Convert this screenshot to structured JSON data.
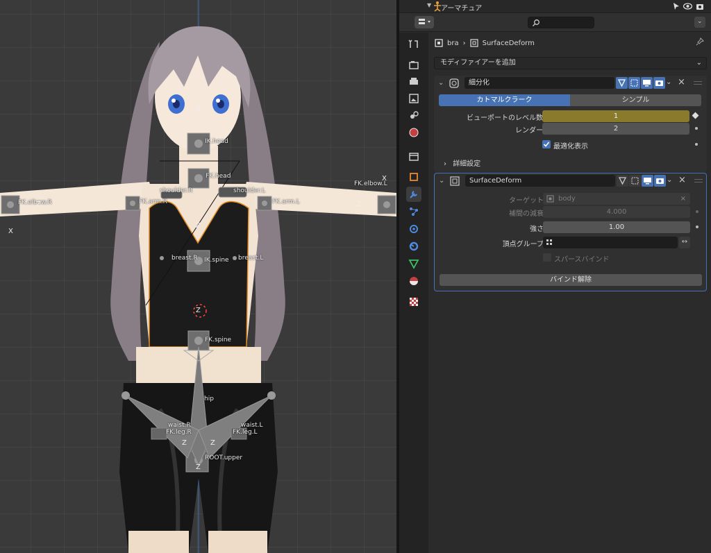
{
  "viewport": {
    "bones": {
      "ik_head": "IK.head",
      "fk_head": "FK.head",
      "shoulder_r": "shoulder.R",
      "shoulder_l": "shoulder.L",
      "fk_arm_r": "FK.arm.R",
      "fk_arm_l": "FK.arm.L",
      "fk_elbow_r": "FK.elbow.R",
      "fk_elbow_l": "FK.elbow.L",
      "breast_r": "breast.R",
      "breast_l": "breast.L",
      "ik_spine": "IK.spine",
      "fk_spine": "FK.spine",
      "hip": "hip",
      "waist_r": "waist.R",
      "waist_l": "waist.L",
      "fk_leg_r": "FK.leg.R",
      "fk_leg_l": "FK.leg.L",
      "root_upper": "ROOT.upper"
    },
    "axis": {
      "z": "Z",
      "x": "X"
    }
  },
  "outliner": {
    "title": "アーマチュア"
  },
  "header": {
    "search_placeholder": ""
  },
  "breadcrumb": {
    "object": "bra",
    "modifier": "SurfaceDeform"
  },
  "add_modifier_label": "モディファイアーを追加",
  "modifiers": [
    {
      "name": "細分化",
      "mode_options": [
        "カトマルクラーク",
        "シンプル"
      ],
      "viewport_levels_label": "ビューポートのレベル数",
      "viewport_levels": "1",
      "render_label": "レンダー",
      "render_levels": "2",
      "optimal_display_label": "最適化表示",
      "advanced_label": "詳細設定"
    },
    {
      "name": "SurfaceDeform",
      "target_label": "ターゲット",
      "target_value": "body",
      "falloff_label": "補間の減衰",
      "falloff_value": "4.000",
      "strength_label": "強さ",
      "strength_value": "1.00",
      "vertex_group_label": "頂点グループ",
      "vertex_group_value": "",
      "sparse_bind_label": "スパースバインド",
      "unbind_label": "バインド解除"
    }
  ],
  "colors": {
    "accent": "#4772b3",
    "gold": "#8a7a2b",
    "panel": "#303030"
  }
}
